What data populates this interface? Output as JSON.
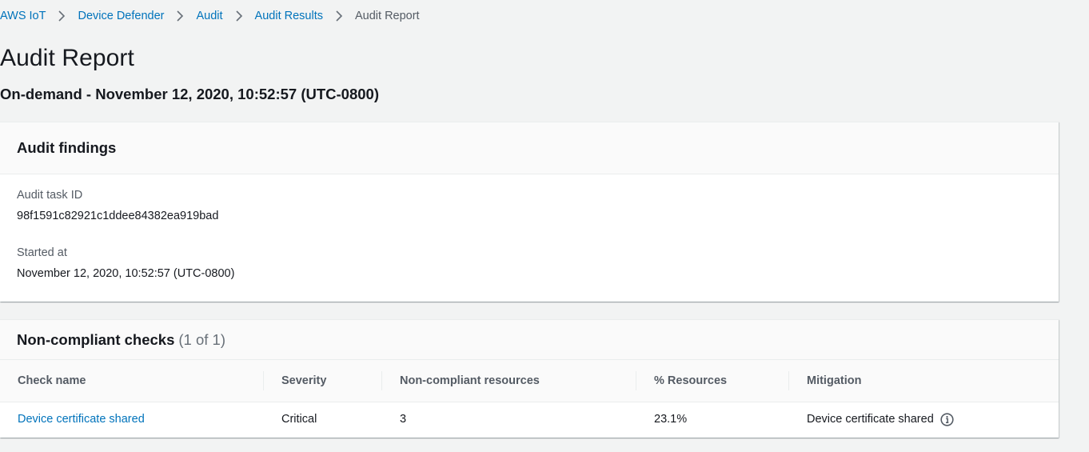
{
  "breadcrumb": {
    "items": [
      {
        "label": "AWS IoT",
        "link": true
      },
      {
        "label": "Device Defender",
        "link": true
      },
      {
        "label": "Audit",
        "link": true
      },
      {
        "label": "Audit Results",
        "link": true
      },
      {
        "label": "Audit Report",
        "link": false
      }
    ]
  },
  "page": {
    "title": "Audit Report",
    "subtitle": "On-demand - November 12, 2020, 10:52:57 (UTC-0800)"
  },
  "findings": {
    "title": "Audit findings",
    "task_id_label": "Audit task ID",
    "task_id_value": "98f1591c82921c1ddee84382ea919bad",
    "started_label": "Started at",
    "started_value": "November 12, 2020, 10:52:57 (UTC-0800)"
  },
  "checks": {
    "title": "Non-compliant checks",
    "count": "(1 of 1)",
    "columns": [
      "Check name",
      "Severity",
      "Non-compliant resources",
      "% Resources",
      "Mitigation"
    ],
    "rows": [
      {
        "check_name": "Device certificate shared",
        "severity": "Critical",
        "resources": "3",
        "percent": "23.1%",
        "mitigation": "Device certificate shared"
      }
    ]
  },
  "colors": {
    "link": "#0073bb",
    "background": "#f2f3f3",
    "panel_header": "#fafafa",
    "text": "#16191f",
    "muted": "#545b64"
  },
  "icons": {
    "breadcrumb_separator": "chevron-right-icon",
    "mitigation_info": "info-icon"
  }
}
